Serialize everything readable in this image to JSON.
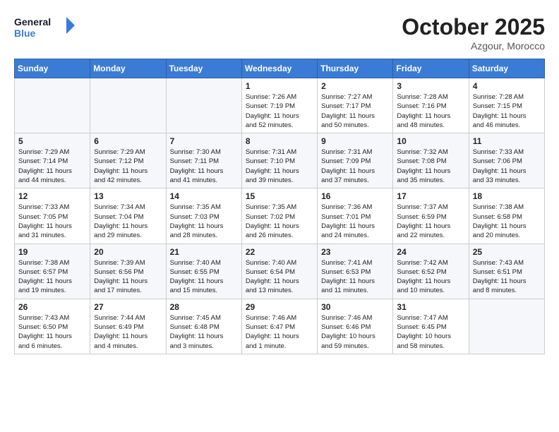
{
  "header": {
    "logo_line1": "General",
    "logo_line2": "Blue",
    "month_title": "October 2025",
    "subtitle": "Azgour, Morocco"
  },
  "weekdays": [
    "Sunday",
    "Monday",
    "Tuesday",
    "Wednesday",
    "Thursday",
    "Friday",
    "Saturday"
  ],
  "weeks": [
    [
      {
        "day": "",
        "info": ""
      },
      {
        "day": "",
        "info": ""
      },
      {
        "day": "",
        "info": ""
      },
      {
        "day": "1",
        "info": "Sunrise: 7:26 AM\nSunset: 7:19 PM\nDaylight: 11 hours\nand 52 minutes."
      },
      {
        "day": "2",
        "info": "Sunrise: 7:27 AM\nSunset: 7:17 PM\nDaylight: 11 hours\nand 50 minutes."
      },
      {
        "day": "3",
        "info": "Sunrise: 7:28 AM\nSunset: 7:16 PM\nDaylight: 11 hours\nand 48 minutes."
      },
      {
        "day": "4",
        "info": "Sunrise: 7:28 AM\nSunset: 7:15 PM\nDaylight: 11 hours\nand 46 minutes."
      }
    ],
    [
      {
        "day": "5",
        "info": "Sunrise: 7:29 AM\nSunset: 7:14 PM\nDaylight: 11 hours\nand 44 minutes."
      },
      {
        "day": "6",
        "info": "Sunrise: 7:29 AM\nSunset: 7:12 PM\nDaylight: 11 hours\nand 42 minutes."
      },
      {
        "day": "7",
        "info": "Sunrise: 7:30 AM\nSunset: 7:11 PM\nDaylight: 11 hours\nand 41 minutes."
      },
      {
        "day": "8",
        "info": "Sunrise: 7:31 AM\nSunset: 7:10 PM\nDaylight: 11 hours\nand 39 minutes."
      },
      {
        "day": "9",
        "info": "Sunrise: 7:31 AM\nSunset: 7:09 PM\nDaylight: 11 hours\nand 37 minutes."
      },
      {
        "day": "10",
        "info": "Sunrise: 7:32 AM\nSunset: 7:08 PM\nDaylight: 11 hours\nand 35 minutes."
      },
      {
        "day": "11",
        "info": "Sunrise: 7:33 AM\nSunset: 7:06 PM\nDaylight: 11 hours\nand 33 minutes."
      }
    ],
    [
      {
        "day": "12",
        "info": "Sunrise: 7:33 AM\nSunset: 7:05 PM\nDaylight: 11 hours\nand 31 minutes."
      },
      {
        "day": "13",
        "info": "Sunrise: 7:34 AM\nSunset: 7:04 PM\nDaylight: 11 hours\nand 29 minutes."
      },
      {
        "day": "14",
        "info": "Sunrise: 7:35 AM\nSunset: 7:03 PM\nDaylight: 11 hours\nand 28 minutes."
      },
      {
        "day": "15",
        "info": "Sunrise: 7:35 AM\nSunset: 7:02 PM\nDaylight: 11 hours\nand 26 minutes."
      },
      {
        "day": "16",
        "info": "Sunrise: 7:36 AM\nSunset: 7:01 PM\nDaylight: 11 hours\nand 24 minutes."
      },
      {
        "day": "17",
        "info": "Sunrise: 7:37 AM\nSunset: 6:59 PM\nDaylight: 11 hours\nand 22 minutes."
      },
      {
        "day": "18",
        "info": "Sunrise: 7:38 AM\nSunset: 6:58 PM\nDaylight: 11 hours\nand 20 minutes."
      }
    ],
    [
      {
        "day": "19",
        "info": "Sunrise: 7:38 AM\nSunset: 6:57 PM\nDaylight: 11 hours\nand 19 minutes."
      },
      {
        "day": "20",
        "info": "Sunrise: 7:39 AM\nSunset: 6:56 PM\nDaylight: 11 hours\nand 17 minutes."
      },
      {
        "day": "21",
        "info": "Sunrise: 7:40 AM\nSunset: 6:55 PM\nDaylight: 11 hours\nand 15 minutes."
      },
      {
        "day": "22",
        "info": "Sunrise: 7:40 AM\nSunset: 6:54 PM\nDaylight: 11 hours\nand 13 minutes."
      },
      {
        "day": "23",
        "info": "Sunrise: 7:41 AM\nSunset: 6:53 PM\nDaylight: 11 hours\nand 11 minutes."
      },
      {
        "day": "24",
        "info": "Sunrise: 7:42 AM\nSunset: 6:52 PM\nDaylight: 11 hours\nand 10 minutes."
      },
      {
        "day": "25",
        "info": "Sunrise: 7:43 AM\nSunset: 6:51 PM\nDaylight: 11 hours\nand 8 minutes."
      }
    ],
    [
      {
        "day": "26",
        "info": "Sunrise: 7:43 AM\nSunset: 6:50 PM\nDaylight: 11 hours\nand 6 minutes."
      },
      {
        "day": "27",
        "info": "Sunrise: 7:44 AM\nSunset: 6:49 PM\nDaylight: 11 hours\nand 4 minutes."
      },
      {
        "day": "28",
        "info": "Sunrise: 7:45 AM\nSunset: 6:48 PM\nDaylight: 11 hours\nand 3 minutes."
      },
      {
        "day": "29",
        "info": "Sunrise: 7:46 AM\nSunset: 6:47 PM\nDaylight: 11 hours\nand 1 minute."
      },
      {
        "day": "30",
        "info": "Sunrise: 7:46 AM\nSunset: 6:46 PM\nDaylight: 10 hours\nand 59 minutes."
      },
      {
        "day": "31",
        "info": "Sunrise: 7:47 AM\nSunset: 6:45 PM\nDaylight: 10 hours\nand 58 minutes."
      },
      {
        "day": "",
        "info": ""
      }
    ]
  ]
}
